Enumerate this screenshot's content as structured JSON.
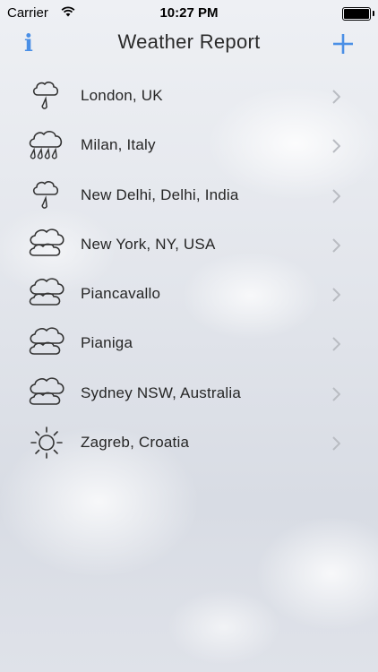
{
  "status_bar": {
    "carrier": "Carrier",
    "time": "10:27 PM"
  },
  "nav": {
    "title": "Weather Report",
    "info_icon": "info-icon",
    "add_icon": "plus-icon"
  },
  "accent_color": "#4a8fe6",
  "locations": [
    {
      "name": "London, UK",
      "icon": "light-rain-icon"
    },
    {
      "name": "Milan, Italy",
      "icon": "heavy-rain-icon"
    },
    {
      "name": "New Delhi, Delhi, India",
      "icon": "light-rain-icon"
    },
    {
      "name": "New York, NY, USA",
      "icon": "cloudy-icon"
    },
    {
      "name": "Piancavallo",
      "icon": "cloudy-icon"
    },
    {
      "name": "Pianiga",
      "icon": "cloudy-icon"
    },
    {
      "name": "Sydney NSW, Australia",
      "icon": "cloudy-icon"
    },
    {
      "name": "Zagreb, Croatia",
      "icon": "sunny-icon"
    }
  ]
}
